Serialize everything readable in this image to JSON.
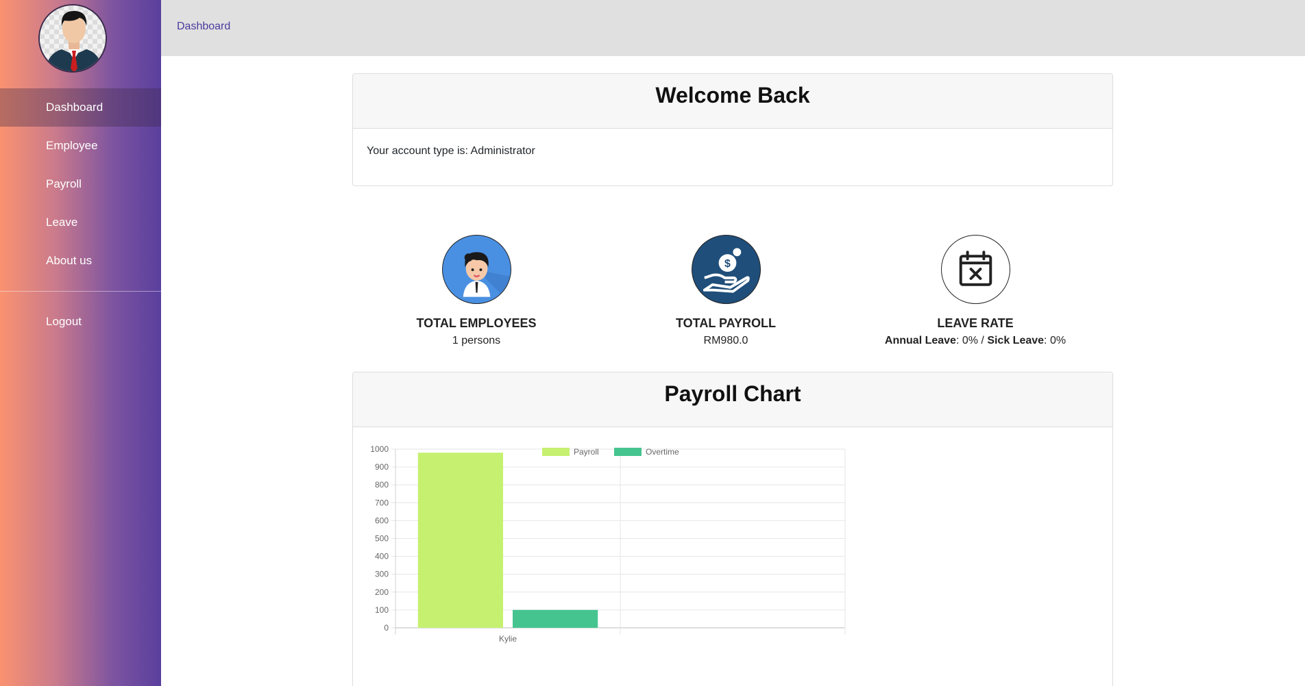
{
  "sidebar": {
    "items": [
      {
        "label": "Dashboard",
        "active": true
      },
      {
        "label": "Employee",
        "active": false
      },
      {
        "label": "Payroll",
        "active": false
      },
      {
        "label": "Leave",
        "active": false
      },
      {
        "label": "About us",
        "active": false
      }
    ],
    "logout_label": "Logout"
  },
  "topbar": {
    "breadcrumb": "Dashboard"
  },
  "welcome": {
    "title": "Welcome Back",
    "account_prefix": "Your account type is: ",
    "account_type": "Administrator"
  },
  "stats": {
    "employees": {
      "title": "TOTAL EMPLOYEES",
      "value": "1 persons"
    },
    "payroll": {
      "title": "TOTAL PAYROLL",
      "value": "RM980.0"
    },
    "leave": {
      "title": "LEAVE RATE",
      "annual_label": "Annual Leave",
      "annual_value": ": 0% / ",
      "sick_label": "Sick Leave",
      "sick_value": ": 0%"
    }
  },
  "chart_card": {
    "title": "Payroll Chart"
  },
  "chart_data": {
    "type": "bar",
    "categories": [
      "Kylie",
      ""
    ],
    "series": [
      {
        "name": "Payroll",
        "values": [
          980,
          null
        ],
        "color": "#c6f070"
      },
      {
        "name": "Overtime",
        "values": [
          100,
          null
        ],
        "color": "#45c490"
      }
    ],
    "ylim": [
      0,
      1000
    ],
    "yticks": [
      0,
      100,
      200,
      300,
      400,
      500,
      600,
      700,
      800,
      900,
      1000
    ],
    "grid": true,
    "legend_position": "top-center"
  }
}
